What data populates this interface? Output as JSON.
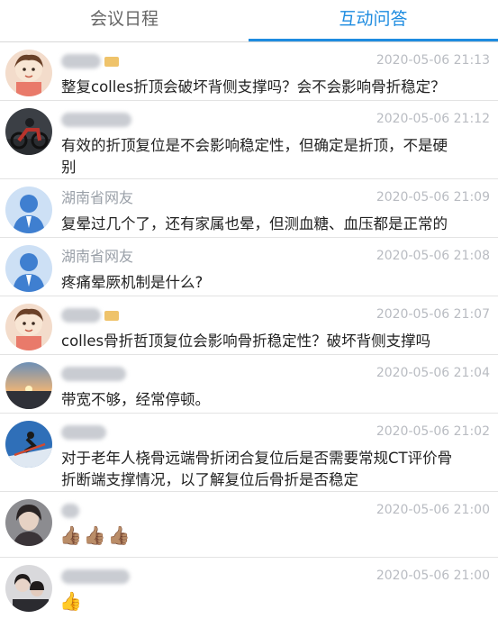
{
  "tabs": {
    "schedule": "会议日程",
    "qa": "互动问答"
  },
  "colors": {
    "accent": "#1e8ce0",
    "name_gray": "#9aa0a8",
    "time_gray": "#b9bcc2"
  },
  "comments": [
    {
      "name": "",
      "time": "2020-05-06 21:13",
      "text": "整复colles折顶会破坏背侧支撑吗？会不会影响骨折稳定？",
      "avatar": "cartoon-boy-avatar"
    },
    {
      "name": "",
      "time": "2020-05-06 21:12",
      "text": "有效的折顶复位是不会影响稳定性，但确定是折顶，不是硬\n别",
      "avatar": "motorcycle-photo-avatar"
    },
    {
      "name": "湖南省网友",
      "time": "2020-05-06 21:09",
      "text": "复晕过几个了，还有家属也晕，但测血糖、血压都是正常的",
      "avatar": "default-person-avatar"
    },
    {
      "name": "湖南省网友",
      "time": "2020-05-06 21:08",
      "text": "疼痛晕厥机制是什么?",
      "avatar": "default-person-avatar"
    },
    {
      "name": "",
      "time": "2020-05-06 21:07",
      "text": "colles骨折哲顶复位会影响骨折稳定性？破坏背侧支撑吗",
      "avatar": "cartoon-boy-avatar"
    },
    {
      "name": "",
      "time": "2020-05-06 21:04",
      "text": "带宽不够，经常停顿。",
      "avatar": "sunset-photo-avatar"
    },
    {
      "name": "",
      "time": "2020-05-06 21:02",
      "text": "对于老年人桡骨远端骨折闭合复位后是否需要常规CT评价骨\n折断端支撑情况，以了解复位后骨折是否稳定",
      "avatar": "skier-photo-avatar"
    },
    {
      "name": "",
      "time": "2020-05-06 21:00",
      "text": "",
      "thumbs": "👍🏽👍🏽👍🏽",
      "avatar": "portrait-photo-avatar"
    },
    {
      "name": "",
      "time": "2020-05-06 21:00",
      "text": "",
      "thumbs": "👍",
      "avatar": "couple-photo-avatar"
    }
  ]
}
